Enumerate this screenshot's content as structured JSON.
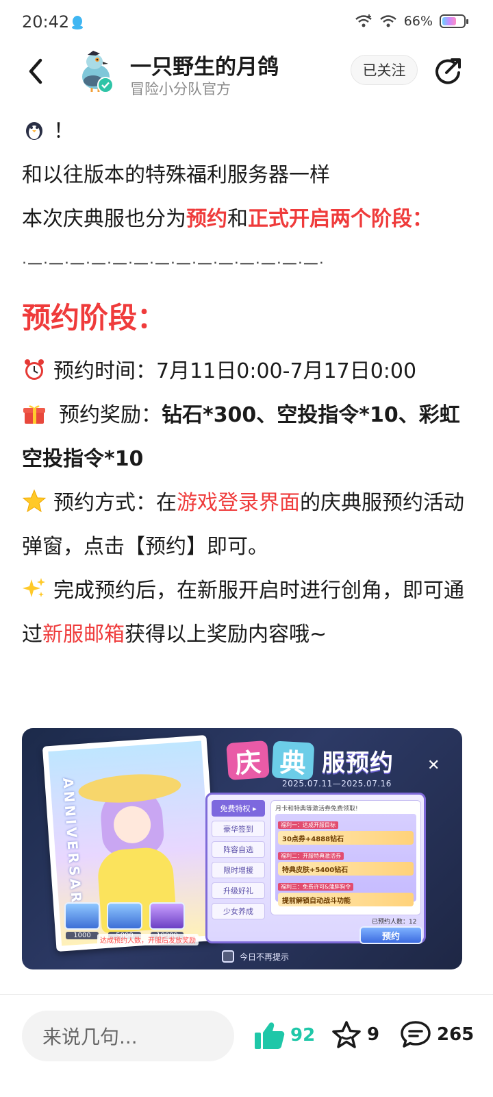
{
  "status_bar": {
    "time": "20:42",
    "battery_text": "66%",
    "battery_level": 0.66,
    "icons": [
      "qq-icon",
      "wifi-plus-icon",
      "wifi-icon",
      "battery-icon"
    ]
  },
  "header": {
    "author_name": "一只野生的月鸽",
    "author_subtitle": "冒险小分队官方",
    "follow_label": "已关注",
    "icons": [
      "back-icon",
      "avatar-pigeon",
      "verified-icon",
      "share-icon"
    ]
  },
  "post": {
    "line_emoji_tail": "！",
    "line1": "和以往版本的特殊福利服务器一样",
    "line2_a": "本次庆典服也分为",
    "line2_b": "预约",
    "line2_c": "和",
    "line2_d": "正式开启两个阶段：",
    "divider": "·—·—·—·—·—·—·—·—·—·—·—·—·—·—·",
    "section_title": "预约阶段：",
    "time_label": "预约时间：7月11日0:00-7月17日0:00",
    "reward_label": "预约奖励：",
    "reward_value": "钻石*300、空投指令*10、彩虹空投指令*10",
    "method_a": "预约方式：在",
    "method_b": "游戏登录界面",
    "method_c": "的庆典服预约活动弹窗，点击【预约】即可。",
    "after_a": "完成预约后，在新服开启时进行创角，即可通过",
    "after_b": "新服邮箱",
    "after_c": "获得以上奖励内容哦~",
    "emoji_icons": [
      "penguin-icon",
      "alarm-clock-icon",
      "gift-icon",
      "star-icon",
      "sparkles-icon"
    ]
  },
  "banner": {
    "title_char1": "庆",
    "title_char2": "典",
    "title_rest": "服预约",
    "date_range": "2025.07.11—2025.07.16",
    "card_side_text": "ANNIVERSARY",
    "menu": [
      "免费特权 ▸",
      "豪华签到",
      "阵容自选",
      "限时增援",
      "升级好礼",
      "少女养成"
    ],
    "rewards_header": "月卡和特典等激活券免费领取!",
    "rewards": [
      {
        "tag": "福利一：达成开服目标",
        "text": "30点券+4888钻石"
      },
      {
        "tag": "福利二：开服特典激活券",
        "text": "特典皮肤+5400钻石"
      },
      {
        "tag": "福利三：免费许可&蒲胖狗令",
        "text": "提前解锁自动战斗功能"
      }
    ],
    "chests": [
      "1000",
      "5000",
      "10000"
    ],
    "warn_note": "达成预约人数，开服后发放奖励",
    "reserve_count": "已预约人数：12",
    "reserve_button": "预约",
    "no_remind": "今日不再提示"
  },
  "bottom_bar": {
    "comment_placeholder": "来说几句...",
    "likes": "92",
    "favorites": "9",
    "comments": "265",
    "accent": "#1fc7a8"
  }
}
